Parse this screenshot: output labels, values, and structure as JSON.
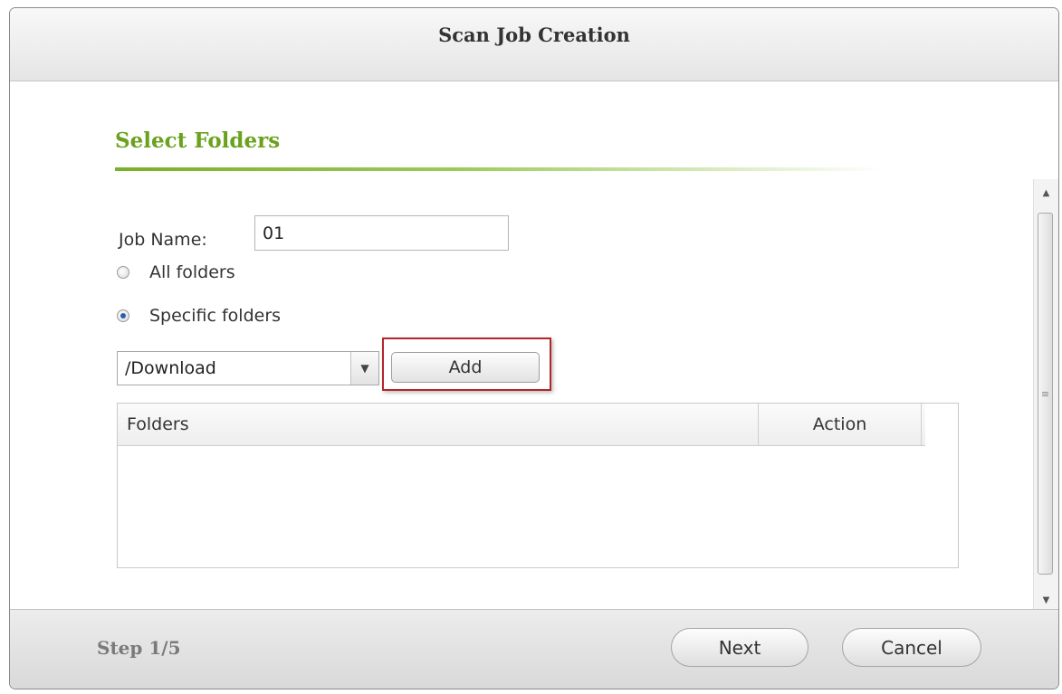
{
  "dialog": {
    "title": "Scan Job Creation"
  },
  "section": {
    "title": "Select Folders"
  },
  "form": {
    "job_name_label": "Job Name:",
    "job_name_value": "01",
    "radio_options": [
      {
        "label": "All folders",
        "checked": false
      },
      {
        "label": "Specific folders",
        "checked": true
      }
    ],
    "folder_select_value": "/Download",
    "add_button_label": "Add"
  },
  "grid": {
    "columns": [
      "Folders",
      "Action"
    ],
    "rows": []
  },
  "footer": {
    "step_label": "Step 1/5",
    "next_label": "Next",
    "cancel_label": "Cancel"
  },
  "colors": {
    "accent_green": "#6aa21e",
    "highlight_red": "#b3262a"
  },
  "icons": {
    "select_arrow": "chevron-down-icon",
    "scroll_up": "scroll-up-icon",
    "scroll_down": "scroll-down-icon"
  }
}
